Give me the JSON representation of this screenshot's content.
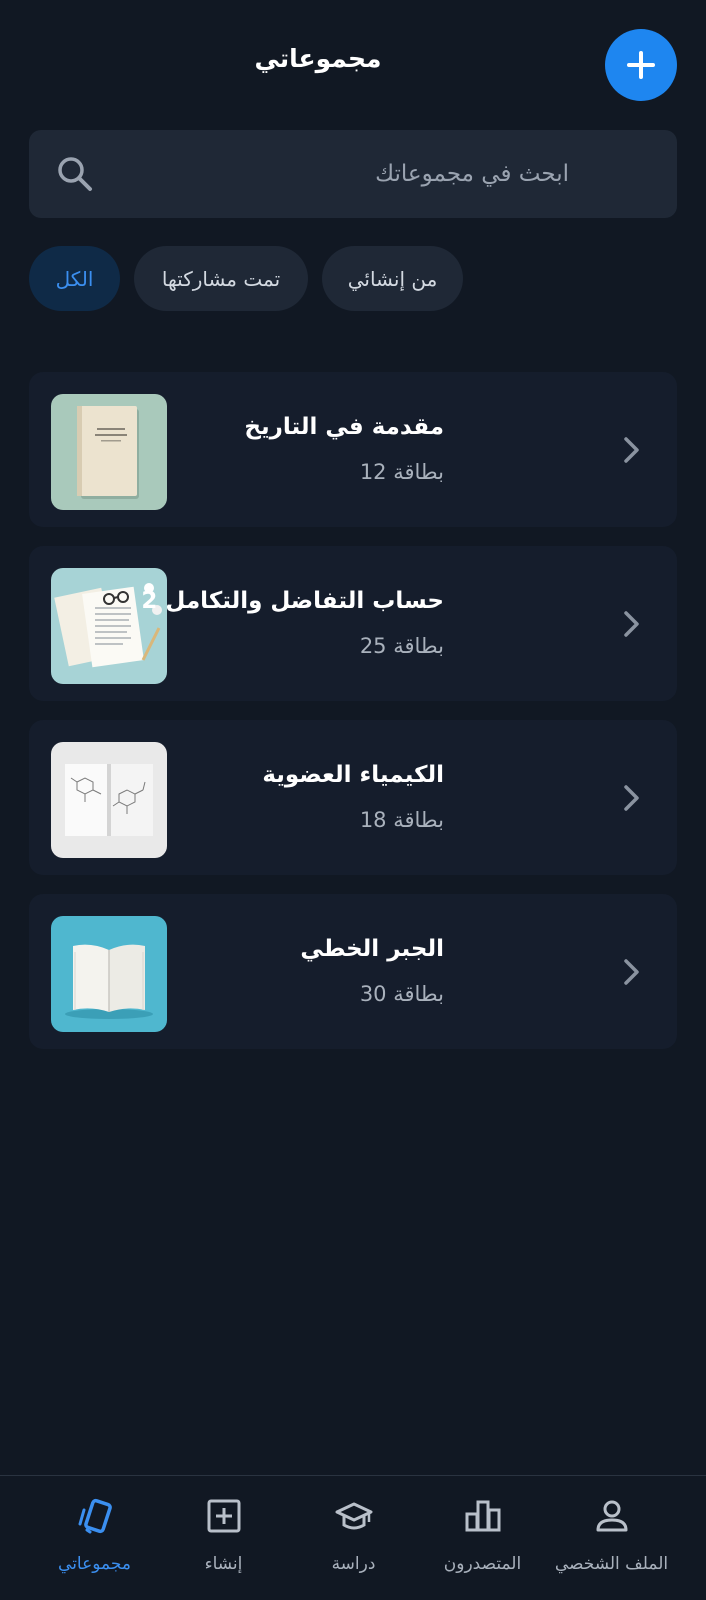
{
  "header": {
    "title": "مجموعاتي",
    "add_icon": "plus-icon"
  },
  "search": {
    "placeholder": "ابحث في مجموعاتك",
    "icon": "search-icon"
  },
  "filters": [
    {
      "label": "الكل",
      "active": true
    },
    {
      "label": "تمت مشاركتها",
      "active": false
    },
    {
      "label": "من إنشائي",
      "active": false
    }
  ],
  "sets": [
    {
      "title": "مقدمة في التاريخ",
      "count": "بطاقة 12",
      "thumb": "closed-book-image"
    },
    {
      "title": "حساب التفاضل والتكامل 2",
      "count": "بطاقة 25",
      "thumb": "papers-glasses-image"
    },
    {
      "title": "الكيمياء العضوية",
      "count": "بطاقة 18",
      "thumb": "chemistry-book-image"
    },
    {
      "title": "الجبر الخطي",
      "count": "بطاقة 30",
      "thumb": "open-book-image"
    }
  ],
  "nav": [
    {
      "label": "مجموعاتي",
      "icon": "cards-icon",
      "active": true
    },
    {
      "label": "إنشاء",
      "icon": "plus-square-icon",
      "active": false
    },
    {
      "label": "دراسة",
      "icon": "graduation-cap-icon",
      "active": false
    },
    {
      "label": "المتصدرون",
      "icon": "bar-chart-icon",
      "active": false
    },
    {
      "label": "الملف الشخصي",
      "icon": "user-icon",
      "active": false
    }
  ],
  "colors": {
    "background": "#111823",
    "card": "#151d2c",
    "accent": "#1e86f0",
    "active_text": "#3b8ff0"
  }
}
